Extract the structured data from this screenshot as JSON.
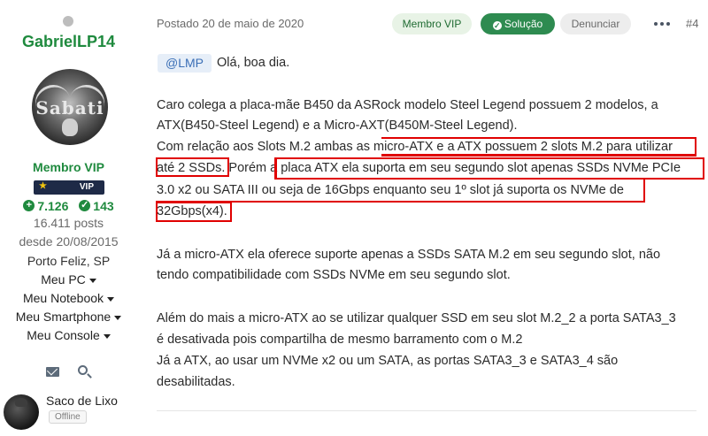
{
  "profile": {
    "username": "GabrielLP14",
    "rank": "Membro VIP",
    "badge_label": "VIP",
    "reactions_positive": "7.126",
    "reactions_solutions": "143",
    "posts": "16.411 posts",
    "joined": "desde 20/08/2015",
    "location": "Porto Feliz, SP",
    "menus": [
      "Meu PC",
      "Meu Notebook",
      "Meu Smartphone",
      "Meu Console"
    ]
  },
  "quoted_user": {
    "name": "Saco de Lixo",
    "status": "Offline"
  },
  "post": {
    "date": "Postado 20 de maio de 2020",
    "badges": {
      "vip": "Membro VIP",
      "solution": "Solução",
      "report": "Denunciar"
    },
    "number": "#4",
    "mention": "@LMP",
    "greeting": "Olá, boa dia.",
    "paragraph1": [
      "Caro colega a placa-mãe B450 da ASRock modelo Steel Legend possuem 2 modelos, a",
      "ATX(B450-Steel Legend) e a Micro-AXT(B450M-Steel Legend).",
      "Com relação aos Slots M.2 ambas as micro-ATX e a ATX possuem 2 slots M.2 para utilizar",
      "até 2 SSDs. Porém a placa ATX ela suporta em seu segundo slot apenas SSDs NVMe PCIe",
      "3.0 x2 ou SATA III ou seja de 16Gbps enquanto seu 1º slot já suporta os NVMe de",
      "32Gbps(x4)."
    ],
    "paragraph2": [
      "Já a micro-ATX ela oferece suporte apenas a SSDs SATA M.2 em seu segundo slot, não",
      "tendo compatibilidade com SSDs NVMe em seu segundo slot."
    ],
    "paragraph3": [
      "Além do mais a micro-ATX ao se utilizar qualquer SSD em seu slot M.2_2 a porta SATA3_3",
      "é desativada pois compartilha de mesmo barramento com o M.2",
      "Já a ATX, ao usar um NVMe x2 ou um SATA, as portas SATA3_3 e SATA3_4 são",
      "desabilitadas."
    ]
  },
  "colors": {
    "accent_green": "#1f8a3e",
    "solution_green": "#2e8b50",
    "highlight_red": "#e00000",
    "mention_blue": "#3b6fb6"
  },
  "icons": [
    "online-status-icon",
    "star-icon",
    "plus-icon",
    "check-icon",
    "mail-icon",
    "search-icon",
    "more-icon"
  ]
}
